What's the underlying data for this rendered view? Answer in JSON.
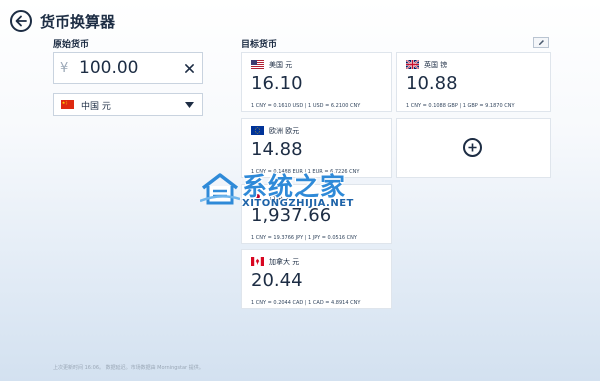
{
  "app": {
    "title": "货币换算器"
  },
  "source": {
    "label": "原始货币",
    "symbol": "¥",
    "amount": "100.00",
    "currency_name": "中国 元",
    "flag_icon": "china-flag-icon"
  },
  "target": {
    "label": "目标货币",
    "cards": [
      {
        "name": "美国 元",
        "value": "16.10",
        "rate": "1 CNY = 0.1610 USD | 1 USD = 6.2100 CNY",
        "flag_icon": "us-flag-icon"
      },
      {
        "name": "英国 镑",
        "value": "10.88",
        "rate": "1 CNY = 0.1088 GBP | 1 GBP = 9.1870 CNY",
        "flag_icon": "uk-flag-icon"
      },
      {
        "name": "欧洲 欧元",
        "value": "14.88",
        "rate": "1 CNY = 0.1488 EUR | 1 EUR = 6.7226 CNY",
        "flag_icon": "eu-flag-icon"
      },
      {
        "name": "日本 元",
        "value": "1,937.66",
        "rate": "1 CNY = 19.3766 JPY | 1 JPY = 0.0516 CNY",
        "flag_icon": "japan-flag-icon"
      },
      {
        "name": "加拿大 元",
        "value": "20.44",
        "rate": "1 CNY = 0.2044 CAD | 1 CAD = 4.8914 CNY",
        "flag_icon": "canada-flag-icon"
      }
    ]
  },
  "footer": {
    "note": "上次更新时间 16:06。 数据延迟。市场数据由 Morningstar 提供。"
  },
  "watermark": {
    "title": "系统之家",
    "subtitle": "XITONGZHIJIA.NET"
  }
}
